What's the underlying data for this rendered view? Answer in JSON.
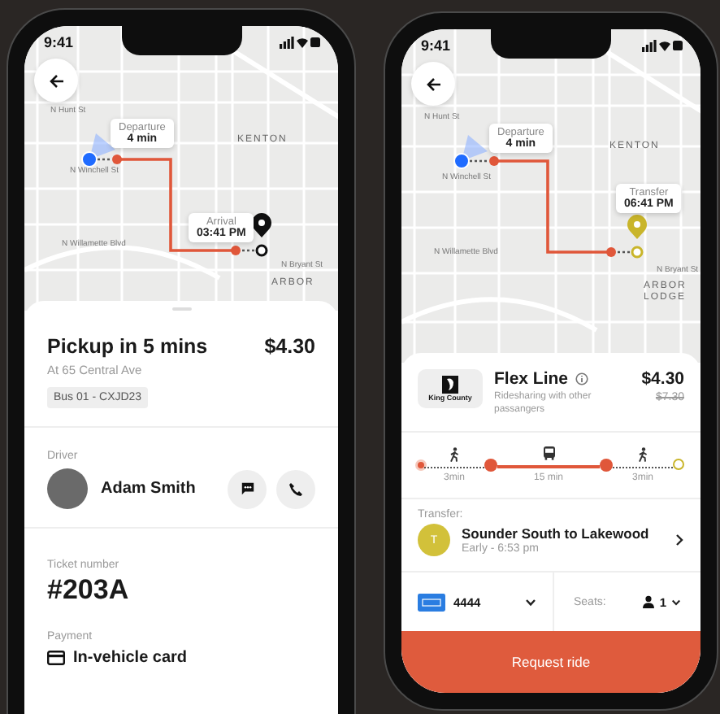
{
  "trip_screen": {
    "status_time": "9:41",
    "map": {
      "labels": [
        "N Hunt St",
        "KENTON",
        "N Winchell St",
        "N Willamette Blvd",
        "N Bryant St",
        "ARBOR"
      ],
      "callouts": [
        {
          "kind": "departure",
          "title": "Departure",
          "value": "4 min"
        },
        {
          "kind": "arrival",
          "title": "Arrival",
          "value": "03:41 PM"
        }
      ]
    },
    "pickup_title": "Pickup in 5 mins",
    "price": "$4.30",
    "address": "At 65 Central Ave",
    "vehicle_tag": "Bus 01 - CXJD23",
    "driver": {
      "label": "Driver",
      "name": "Adam Smith"
    },
    "ticket": {
      "label": "Ticket number",
      "value": "#203A"
    },
    "payment": {
      "label": "Payment",
      "method": "In-vehicle card"
    }
  },
  "booking_screen": {
    "status_time": "9:41",
    "map": {
      "labels": [
        "N Hunt St",
        "KENTON",
        "N Winchell St",
        "N Willamette Blvd",
        "N Bryant St",
        "ARBOR",
        "LODGE"
      ],
      "callouts": [
        {
          "kind": "departure",
          "title": "Departure",
          "value": "4 min"
        },
        {
          "kind": "transfer",
          "title": "Transfer",
          "value": "06:41 PM"
        }
      ]
    },
    "service": {
      "logo_text": "King County",
      "name": "Flex Line",
      "description": "Ridesharing with other passangers",
      "price": "$4.30",
      "original_price": "$7.30"
    },
    "legs": [
      {
        "kind": "walk",
        "duration": "3min"
      },
      {
        "kind": "bus",
        "duration": "15 min"
      },
      {
        "kind": "walk",
        "duration": "3min"
      }
    ],
    "transfer": {
      "label": "Transfer:",
      "initial": "T",
      "name": "Sounder South to Lakewood",
      "time": "Early - 6:53 pm"
    },
    "payment": {
      "card": "4444"
    },
    "seats": {
      "label": "Seats:",
      "count": "1"
    },
    "action": "Request ride"
  }
}
